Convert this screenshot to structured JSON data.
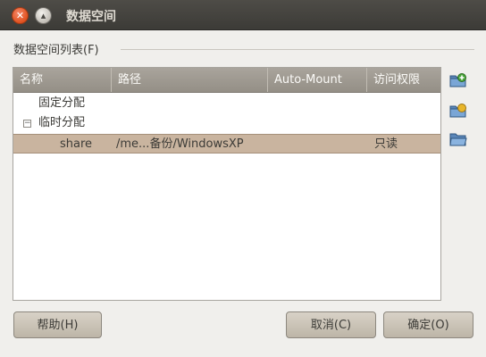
{
  "window": {
    "title": "数据空间"
  },
  "group": {
    "label": "数据空间列表(F)"
  },
  "table": {
    "columns": [
      "名称",
      "路径",
      "Auto-Mount",
      "访问权限"
    ],
    "rows": [
      {
        "name": "固定分配",
        "path": "",
        "auto_mount": "",
        "access": ""
      },
      {
        "name": "临时分配",
        "expander": "−",
        "path": "",
        "auto_mount": "",
        "access": ""
      },
      {
        "name": "share",
        "path": "/me...备份/WindowsXP",
        "auto_mount": "",
        "access": "只读"
      }
    ]
  },
  "side_buttons": [
    "add-share-icon",
    "edit-share-icon",
    "remove-share-icon"
  ],
  "buttons": {
    "help": "帮助(H)",
    "cancel": "取消(C)",
    "ok": "确定(O)"
  },
  "colors": {
    "titlebar": "#3c3b37",
    "selection": "#c9b49f",
    "header": "#9f9a91",
    "close_button": "#e0511f"
  }
}
